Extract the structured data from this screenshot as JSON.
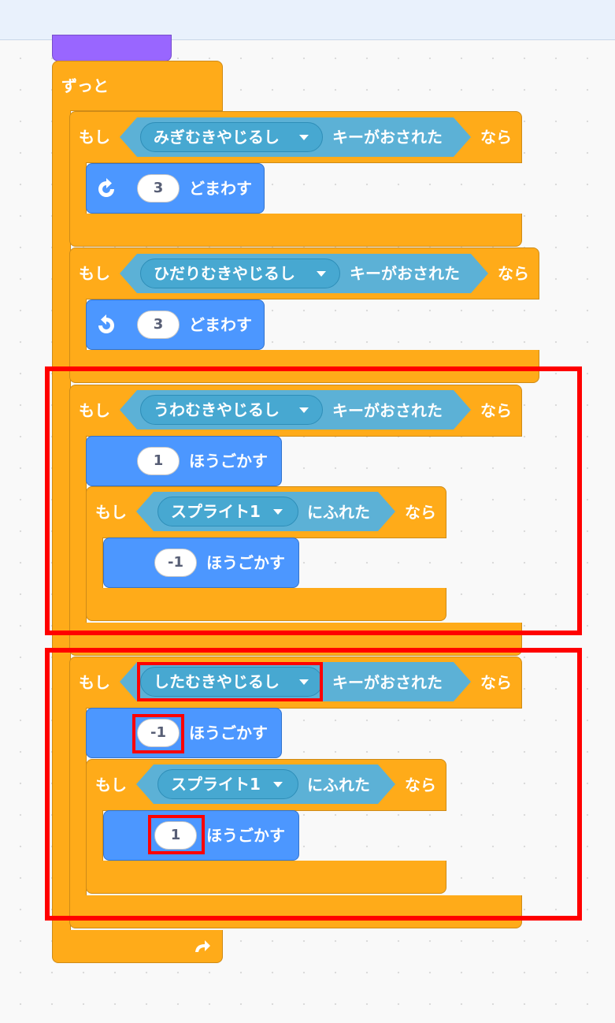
{
  "forever": {
    "label": "ずっと"
  },
  "if_label": "もし",
  "then_label": "なら",
  "key_pressed_label": "キーがおされた",
  "touching_label": "にふれた",
  "blocks": {
    "right": {
      "key": "みぎむきやじるし",
      "turn_value": "3",
      "turn_label": "どまわす"
    },
    "left": {
      "key": "ひだりむきやじるし",
      "turn_value": "3",
      "turn_label": "どまわす"
    },
    "up": {
      "key": "うわむきやじるし",
      "move_value": "1",
      "move_label": "ほうごかす",
      "touch_target": "スプライト1",
      "inner_move_value": "-1",
      "inner_move_label": "ほうごかす"
    },
    "down": {
      "key": "したむきやじるし",
      "move_value": "-1",
      "move_label": "ほうごかす",
      "touch_target": "スプライト1",
      "inner_move_value": "1",
      "inner_move_label": "ほうごかす"
    }
  },
  "colors": {
    "control": "#ffab19",
    "motion": "#4c97ff",
    "sensing": "#5cb1d6",
    "events": "#9966ff",
    "highlight": "#ff0000"
  }
}
